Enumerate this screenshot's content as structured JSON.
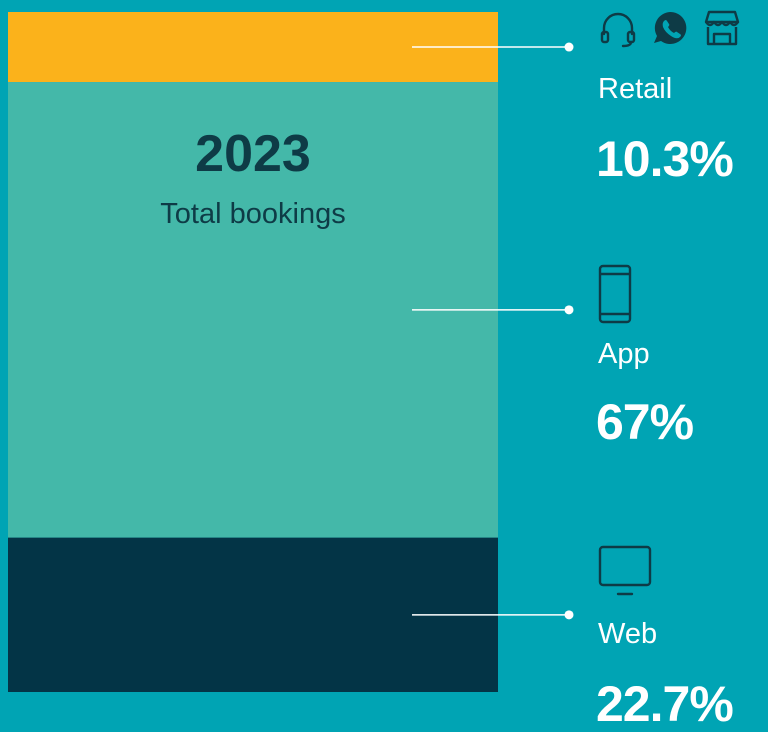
{
  "header": {
    "year": "2023",
    "subtitle": "Total bookings"
  },
  "colors": {
    "background": "#00A4B4",
    "retail": "#FBB21B",
    "app": "#44B8A9",
    "web": "#033446",
    "leader": "#FFFFFF",
    "icon": "#0E3B46"
  },
  "segments": [
    {
      "label": "Retail",
      "value_label": "10.3%",
      "icons": [
        "headset-icon",
        "whatsapp-icon",
        "store-icon"
      ]
    },
    {
      "label": "App",
      "value_label": "67%",
      "icons": [
        "smartphone-icon"
      ]
    },
    {
      "label": "Web",
      "value_label": "22.7%",
      "icons": [
        "desktop-monitor-icon"
      ]
    }
  ],
  "chart_data": {
    "type": "bar",
    "stacked": true,
    "orientation": "vertical",
    "title": "2023",
    "subtitle": "Total bookings",
    "unit": "%",
    "categories": [
      "2023"
    ],
    "series": [
      {
        "name": "Retail",
        "values": [
          10.3
        ],
        "color": "#FBB21B"
      },
      {
        "name": "App",
        "values": [
          67
        ],
        "color": "#44B8A9"
      },
      {
        "name": "Web",
        "values": [
          22.7
        ],
        "color": "#033446"
      }
    ],
    "stack_order_top_to_bottom": [
      "Retail",
      "App",
      "Web"
    ],
    "ylim": [
      0,
      100
    ],
    "grid": false,
    "legend": "right"
  }
}
